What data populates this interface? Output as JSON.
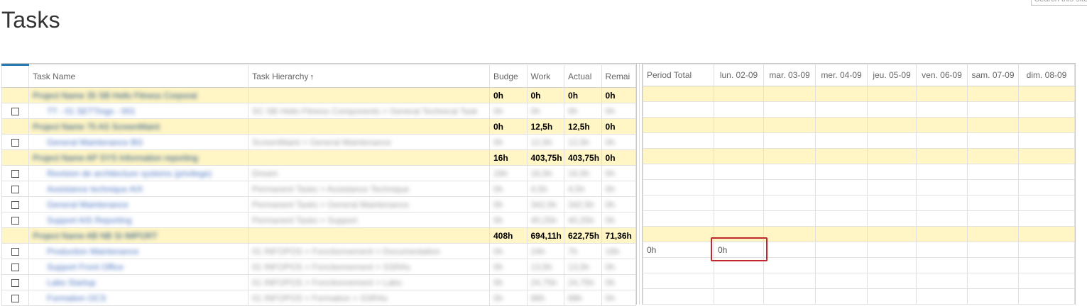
{
  "page": {
    "title": "Tasks",
    "search_placeholder": "Search this site"
  },
  "grid": {
    "left_headers": [
      "",
      "Task Name",
      "Task Hierarchy",
      "Budget",
      "Work",
      "Actual",
      "Remaining"
    ],
    "left_header_display": [
      "",
      "Task Name",
      "Task Hierarchy",
      "Budge",
      "Work",
      "Actual",
      "Remai"
    ],
    "sort_icon": "sort-ascending-icon",
    "right_headers": [
      "Period Total",
      "lun. 02-09",
      "mar. 03-09",
      "mer. 04-09",
      "jeu. 05-09",
      "ven. 06-09",
      "sam. 07-09",
      "dim. 08-09"
    ],
    "rows": [
      {
        "type": "summary",
        "name": "Project Name 35 SB Hello Fitness Corporat",
        "hierarchy": "",
        "budget": "0h",
        "work": "0h",
        "actual": "0h",
        "remaining": "0h",
        "period": "",
        "day1": ""
      },
      {
        "type": "task",
        "name": "TT - 01 SETTings - 001",
        "hierarchy": "SC SB Hello Fitness Components > General Technical Task",
        "budget": "0h",
        "work": "0h",
        "actual": "0h",
        "remaining": "0h",
        "period": "",
        "day1": ""
      },
      {
        "type": "summary",
        "name": "Project Name 75 AS ScreenMaint",
        "hierarchy": "",
        "budget": "0h",
        "work": "12,5h",
        "actual": "12,5h",
        "remaining": "0h",
        "period": "",
        "day1": ""
      },
      {
        "type": "task",
        "name": "General Maintenance BG",
        "hierarchy": "ScreenMaint > General Maintenance",
        "budget": "0h",
        "work": "12,5h",
        "actual": "12,5h",
        "remaining": "0h",
        "period": "",
        "day1": ""
      },
      {
        "type": "summary",
        "name": "Project Name AP SYS Information reporting",
        "hierarchy": "",
        "budget": "16h",
        "work": "403,75h",
        "actual": "403,75h",
        "remaining": "0h",
        "period": "",
        "day1": ""
      },
      {
        "type": "task",
        "name": "Revision de architecture systems (privilege)",
        "hierarchy": "Dream",
        "budget": "16h",
        "work": "16,5h",
        "actual": "16,5h",
        "remaining": "0h",
        "period": "",
        "day1": ""
      },
      {
        "type": "task",
        "name": "Assistance technique AIX",
        "hierarchy": "Permanent Tasks > Assistance Technique",
        "budget": "0h",
        "work": "4,5h",
        "actual": "4,5h",
        "remaining": "0h",
        "period": "",
        "day1": ""
      },
      {
        "type": "task",
        "name": "General Maintenance",
        "hierarchy": "Permanent Tasks > General Maintenance",
        "budget": "0h",
        "work": "342,5h",
        "actual": "342,5h",
        "remaining": "0h",
        "period": "",
        "day1": ""
      },
      {
        "type": "task",
        "name": "Support AIS Reporting",
        "hierarchy": "Permanent Tasks > Support",
        "budget": "0h",
        "work": "40,25h",
        "actual": "40,25h",
        "remaining": "0h",
        "period": "",
        "day1": ""
      },
      {
        "type": "summary",
        "name": "Project Name AB NB SI IMPORT",
        "hierarchy": "",
        "budget": "408h",
        "work": "694,11h",
        "actual": "622,75h",
        "remaining": "71,36h",
        "period": "",
        "day1": ""
      },
      {
        "type": "task",
        "name": "Production Maintenance",
        "hierarchy": "01 INFOPOS > Fonctionnement > Documentation",
        "budget": "0h",
        "work": "24h",
        "actual": "7h",
        "remaining": "16h",
        "period": "0h",
        "day1": "0h"
      },
      {
        "type": "task",
        "name": "Support Front Office",
        "hierarchy": "01 INFOPOS > Fonctionnement > SSRAs",
        "budget": "0h",
        "work": "13,5h",
        "actual": "13,5h",
        "remaining": "0h",
        "period": "",
        "day1": ""
      },
      {
        "type": "task",
        "name": "Labo Startup",
        "hierarchy": "01 INFOPOS > Fonctionnement > Labo",
        "budget": "0h",
        "work": "24,75h",
        "actual": "24,75h",
        "remaining": "0h",
        "period": "",
        "day1": ""
      },
      {
        "type": "task",
        "name": "Formation OCS",
        "hierarchy": "01 INFOPOS > Formation > SSRAs",
        "budget": "0h",
        "work": "88h",
        "actual": "88h",
        "remaining": "0h",
        "period": "",
        "day1": ""
      }
    ]
  },
  "colors": {
    "summary_bg": "#fff5c5",
    "highlight_border": "#c0282e",
    "link": "#4a73c2",
    "accent": "#2a7ab0"
  }
}
